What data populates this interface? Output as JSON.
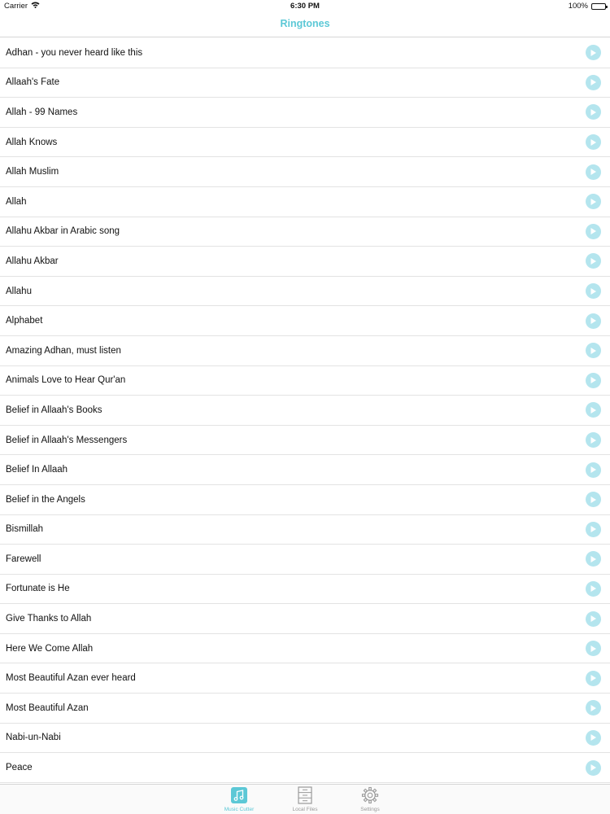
{
  "status_bar": {
    "carrier": "Carrier",
    "time": "6:30 PM",
    "battery": "100%"
  },
  "nav": {
    "title": "Ringtones"
  },
  "ringtones": [
    "Adhan - you never heard like this",
    "Allaah's Fate",
    "Allah - 99 Names",
    "Allah Knows",
    "Allah Muslim",
    "Allah",
    "Allahu Akbar in Arabic song",
    "Allahu Akbar",
    "Allahu",
    "Alphabet",
    "Amazing Adhan, must listen",
    "Animals Love to Hear Qur'an",
    "Belief in Allaah's Books",
    "Belief in Allaah's Messengers",
    "Belief In Allaah",
    "Belief in the Angels",
    "Bismillah",
    "Farewell",
    "Fortunate is He",
    "Give Thanks to Allah",
    "Here We Come Allah",
    "Most Beautiful Azan ever heard",
    "Most Beautiful Azan",
    "Nabi-un-Nabi",
    "Peace"
  ],
  "tabs": {
    "music_cutter": "Music Cutter",
    "local_files": "Local Files",
    "settings": "Settings"
  },
  "icons": {
    "play": "play-icon",
    "wifi": "wifi-icon",
    "battery": "battery-icon",
    "music": "music-note-icon",
    "files": "file-cabinet-icon",
    "settings": "gear-icon"
  },
  "colors": {
    "accent": "#5cc8d6",
    "play_button": "#b4e5ee",
    "inactive_tab": "#9a9a9a"
  }
}
